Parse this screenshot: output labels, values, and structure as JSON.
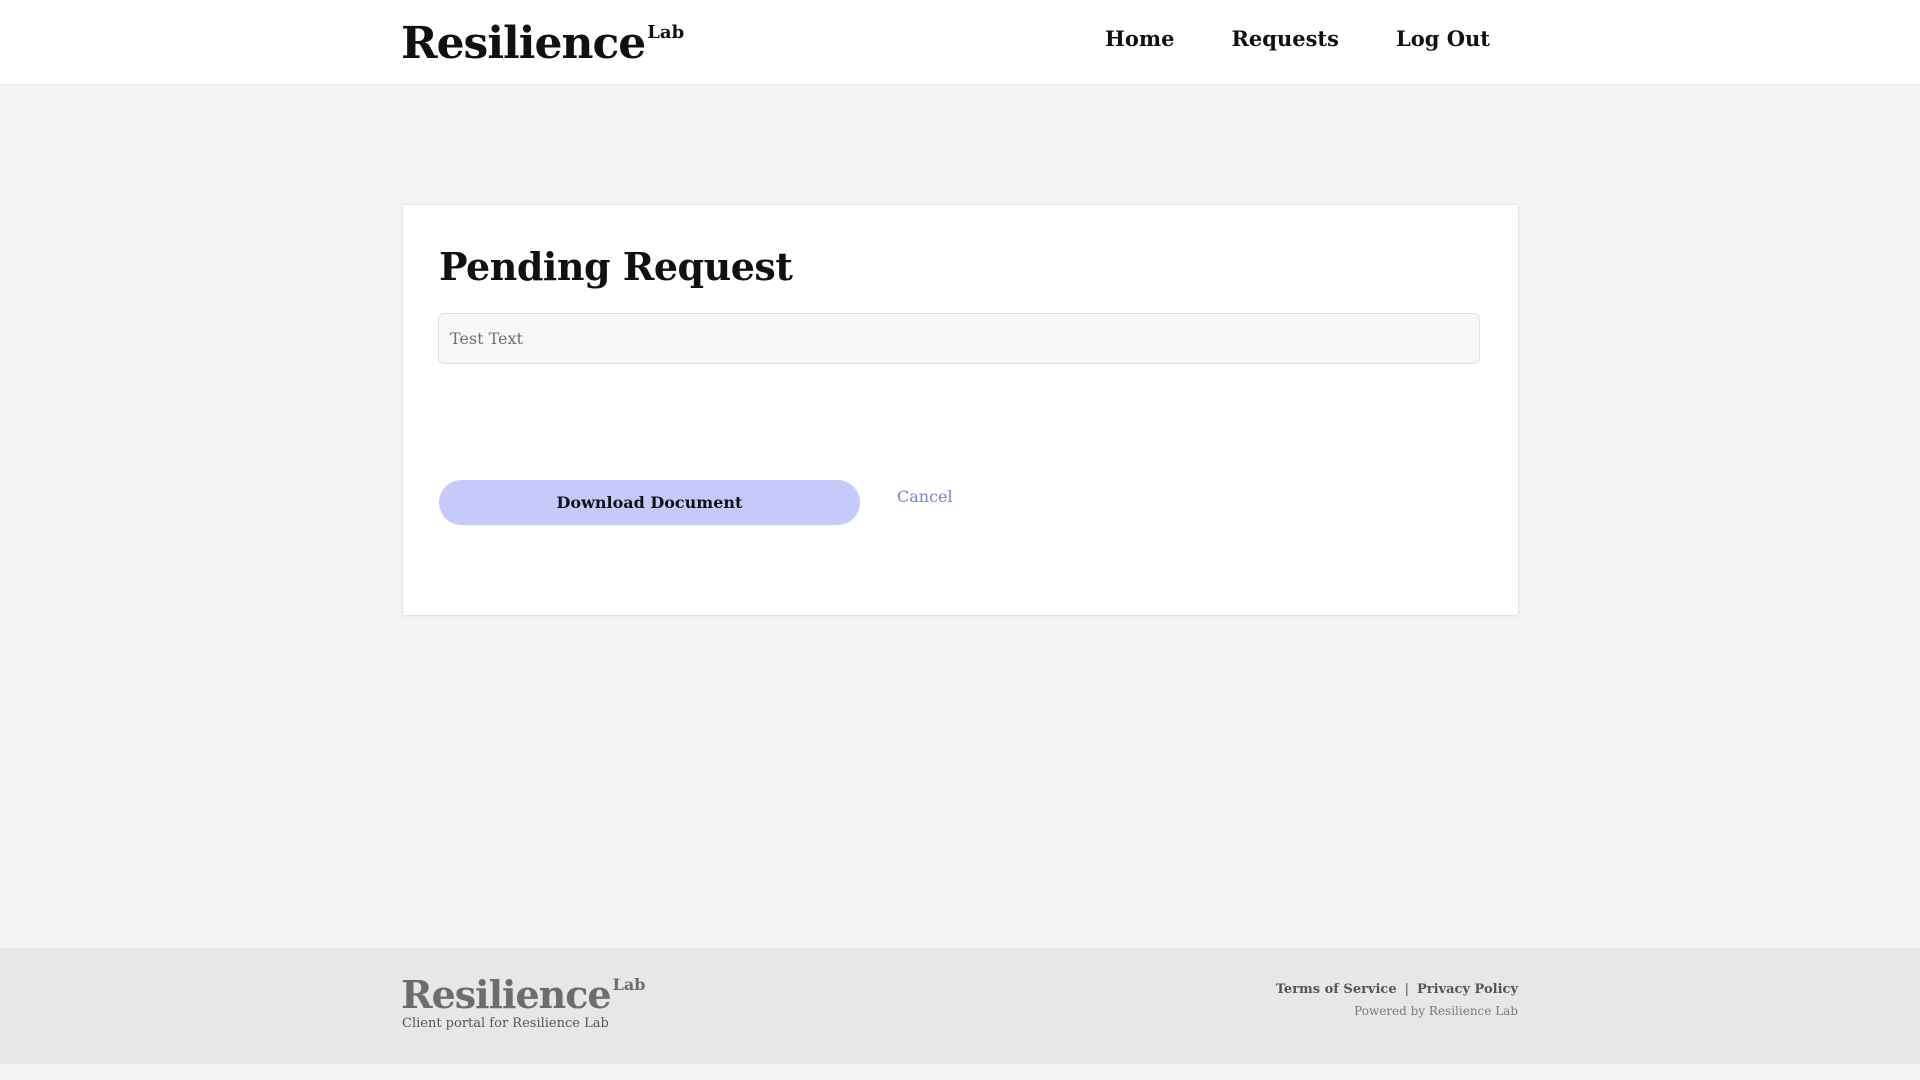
{
  "header": {
    "brand": "Resilience",
    "brand_sup": "Lab",
    "nav": {
      "home": "Home",
      "requests": "Requests",
      "logout": "Log Out"
    }
  },
  "main": {
    "title": "Pending Request",
    "text_field_value": "Test Text",
    "download_label": "Download Document",
    "cancel_label": "Cancel"
  },
  "footer": {
    "brand": "Resilience",
    "brand_sup": "Lab",
    "tagline": "Client portal for Resilience Lab",
    "terms": "Terms of Service",
    "separator": "|",
    "privacy": "Privacy Policy",
    "powered": "Powered by Resilience Lab"
  },
  "colors": {
    "background": "#f5f4f2",
    "primary_button": "#c5cafb",
    "link": "#7a7fd6",
    "footer_bg": "#e8e7e5"
  }
}
